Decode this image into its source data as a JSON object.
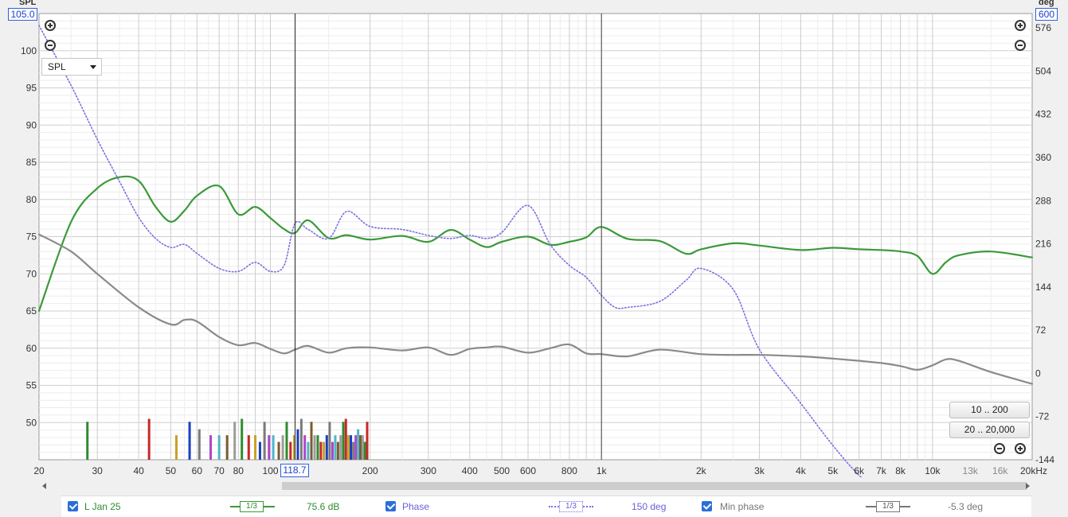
{
  "colors": {
    "spl": "#3a9a3a",
    "phase": "#7a6fe0",
    "minphase": "#8a8a8a",
    "bars": [
      "#2e8b2e",
      "#c62828",
      "#c9a227",
      "#1a3fbf",
      "#7b7b7b",
      "#ad47c9",
      "#4fb6c8",
      "#7a5c2e",
      "#9c9c9c"
    ]
  },
  "left_axis": {
    "unit": "SPL",
    "top_value": "105.0"
  },
  "right_axis": {
    "unit": "deg",
    "top_value": "600"
  },
  "dropdown": {
    "selected": "SPL"
  },
  "cursor": {
    "frequency_label": "118.7"
  },
  "range_buttons": {
    "low": "10 .. 200",
    "full": "20 .. 20,000"
  },
  "legend": {
    "spl": {
      "name": "L Jan 25",
      "smoothing": "1/3",
      "value": "75.6 dB"
    },
    "phase": {
      "name": "Phase",
      "smoothing": "1/3",
      "value": "150 deg"
    },
    "minphase": {
      "name": "Min phase",
      "smoothing": "1/3",
      "value": "-5.3 deg"
    }
  },
  "chart_data": {
    "type": "line",
    "xscale": "log",
    "xlim": [
      20,
      20000
    ],
    "ylim": [
      45,
      105
    ],
    "y2lim": [
      -144,
      600
    ],
    "x_ticks": [
      "20",
      "30",
      "40",
      "50",
      "60",
      "70",
      "80",
      "100",
      "200",
      "300",
      "400",
      "500",
      "600",
      "800",
      "1k",
      "2k",
      "3k",
      "4k",
      "5k",
      "6k",
      "7k",
      "8k",
      "10k",
      "13k",
      "16k",
      "20kHz"
    ],
    "y_ticks": [
      "100",
      "95",
      "90",
      "85",
      "80",
      "75",
      "70",
      "65",
      "60",
      "55",
      "50"
    ],
    "y2_ticks": [
      "576",
      "504",
      "432",
      "360",
      "288",
      "216",
      "144",
      "72",
      "0",
      "-72",
      "-144"
    ],
    "series": [
      {
        "name": "L Jan 25",
        "axis": "left",
        "x": [
          20,
          25,
          30,
          35,
          40,
          45,
          50,
          55,
          60,
          70,
          80,
          90,
          100,
          110,
          118.7,
          130,
          150,
          170,
          200,
          250,
          300,
          350,
          400,
          450,
          500,
          600,
          700,
          800,
          900,
          1000,
          1200,
          1500,
          1800,
          2000,
          2500,
          3000,
          4000,
          5000,
          6000,
          7000,
          8000,
          9000,
          10000,
          11000,
          12000,
          15000,
          20000
        ],
        "values": [
          65,
          77,
          81.5,
          83,
          82.5,
          79,
          77,
          78.5,
          80.5,
          81.8,
          78,
          79,
          77.5,
          76,
          75.5,
          77.2,
          74.8,
          75.2,
          74.6,
          75.1,
          74.3,
          75.9,
          74.6,
          73.6,
          74.3,
          75,
          73.9,
          74.3,
          74.9,
          76.3,
          74.7,
          74.4,
          72.7,
          73.3,
          74.1,
          73.8,
          73.2,
          73.5,
          73.3,
          73.2,
          73,
          72.4,
          70,
          71.6,
          72.5,
          73,
          72.2
        ]
      },
      {
        "name": "Phase",
        "axis": "right",
        "x": [
          20,
          25,
          30,
          35,
          40,
          45,
          50,
          55,
          60,
          70,
          80,
          90,
          100,
          110,
          118.7,
          130,
          150,
          170,
          200,
          250,
          300,
          350,
          400,
          450,
          500,
          600,
          700,
          800,
          900,
          1000,
          1100,
          1200,
          1500,
          1800,
          2000,
          2500,
          3000,
          4000,
          5000,
          6000,
          7000,
          8000,
          9000,
          10000,
          11000,
          12000,
          15000,
          20000
        ],
        "values": [
          580,
          480,
          390,
          320,
          260,
          225,
          210,
          215,
          200,
          175,
          170,
          185,
          170,
          180,
          250,
          240,
          225,
          270,
          245,
          240,
          230,
          225,
          230,
          225,
          235,
          280,
          215,
          180,
          160,
          130,
          110,
          110,
          120,
          155,
          175,
          140,
          40,
          -50,
          -120,
          -170,
          -200,
          -220,
          -245,
          -225,
          -215,
          -220,
          -230,
          -238
        ]
      },
      {
        "name": "Min phase",
        "axis": "left",
        "x": [
          20,
          25,
          30,
          40,
          50,
          55,
          60,
          70,
          80,
          90,
          100,
          110,
          118.7,
          130,
          150,
          170,
          200,
          250,
          300,
          350,
          400,
          450,
          500,
          600,
          700,
          800,
          900,
          1000,
          1200,
          1500,
          2000,
          2500,
          3000,
          4000,
          5000,
          6000,
          7000,
          8000,
          9000,
          10000,
          11000,
          12000,
          15000,
          20000
        ],
        "values": [
          75.3,
          73,
          70,
          65.5,
          63.2,
          63.8,
          63.6,
          61.5,
          60.4,
          60.7,
          59.9,
          59.3,
          59.8,
          60.3,
          59.4,
          60,
          60.1,
          59.7,
          60.1,
          59.1,
          59.9,
          60.1,
          60.2,
          59.4,
          60,
          60.5,
          59.3,
          59.2,
          58.9,
          59.8,
          59.2,
          59.1,
          59.1,
          58.9,
          58.6,
          58.3,
          58,
          57.6,
          57.1,
          57.7,
          58.5,
          58.3,
          56.8,
          55.2
        ]
      }
    ],
    "markers": {
      "x": [
        28,
        43,
        52,
        57,
        61,
        66,
        70,
        74,
        78,
        82,
        86,
        90,
        93,
        96,
        99,
        102,
        106,
        109,
        112,
        115,
        118,
        121,
        124,
        127,
        130,
        133,
        136,
        139,
        142,
        145,
        148,
        151,
        154,
        157,
        160,
        163,
        166,
        169,
        172,
        175,
        178,
        181,
        184,
        187,
        190,
        193,
        196
      ],
      "heights": [
        50.1,
        50.5,
        48.3,
        50.1,
        49.1,
        48.3,
        48.3,
        48.3,
        50.1,
        50.5,
        48.3,
        48.3,
        47.4,
        50.1,
        48.3,
        48.3,
        47.4,
        48.3,
        50.1,
        47.4,
        48.3,
        49.1,
        50.5,
        48.3,
        47.4,
        50.1,
        48.3,
        48.3,
        47.4,
        47.4,
        48.3,
        50.1,
        47.4,
        48.3,
        47.4,
        48.3,
        50.1,
        50.5,
        48.3,
        48.3,
        47.4,
        48.3,
        49.1,
        48.3,
        48.3,
        47.4,
        50.1
      ]
    }
  }
}
